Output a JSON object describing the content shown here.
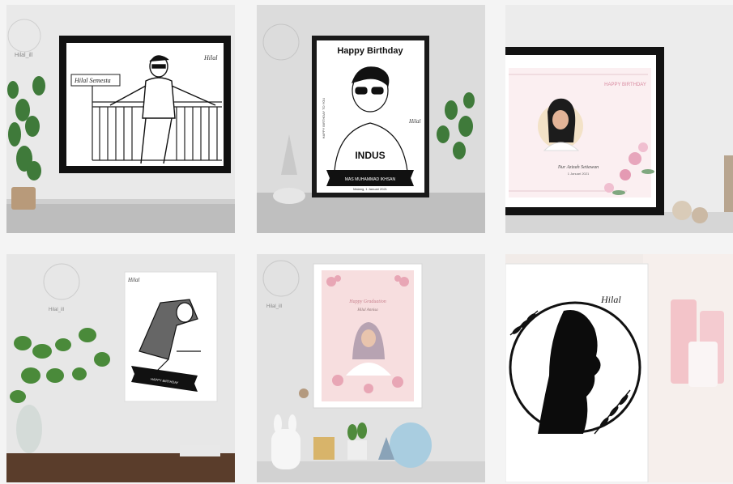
{
  "tiles": [
    {
      "frame_caption": "Hilal Semesta"
    },
    {
      "frame_title": "Happy Birthday",
      "side_text_left": "HAPPY BIRTHDAY TO YOU",
      "banner": "MAS MUHAMMAD IKHSAN",
      "footer": "Malang, 1 Januari 2021",
      "shirt_text": "INDUS"
    },
    {
      "title": "HAPPY BIRTHDAY",
      "name": "Nur Azizah Setiawan",
      "date": "1 Januari 2021"
    },
    {
      "banner": "HAPPY BIRTHDAY"
    },
    {
      "title": "Happy Graduation",
      "subtitle": "Hilal Annisa"
    },
    {
      "signature": "Hilal"
    }
  ],
  "watermark": "Hilal_ill",
  "signature_mark": "Hilal"
}
